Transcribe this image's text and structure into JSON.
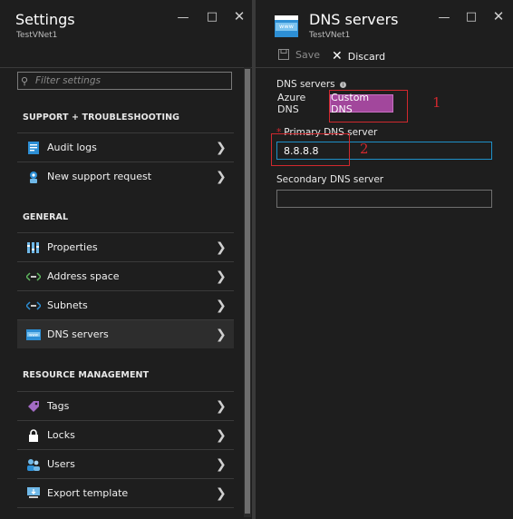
{
  "left_blade": {
    "title": "Settings",
    "subtitle": "TestVNet1",
    "search_placeholder": "Filter settings",
    "sections": [
      {
        "title": "SUPPORT + TROUBLESHOOTING",
        "items": [
          {
            "label": "Audit logs",
            "icon": "audit-logs-icon"
          },
          {
            "label": "New support request",
            "icon": "support-icon"
          }
        ]
      },
      {
        "title": "GENERAL",
        "items": [
          {
            "label": "Properties",
            "icon": "properties-icon"
          },
          {
            "label": "Address space",
            "icon": "address-space-icon"
          },
          {
            "label": "Subnets",
            "icon": "subnets-icon"
          },
          {
            "label": "DNS servers",
            "icon": "dns-servers-icon",
            "selected": true
          }
        ]
      },
      {
        "title": "RESOURCE MANAGEMENT",
        "items": [
          {
            "label": "Tags",
            "icon": "tag-icon"
          },
          {
            "label": "Locks",
            "icon": "lock-icon"
          },
          {
            "label": "Users",
            "icon": "users-icon"
          },
          {
            "label": "Export template",
            "icon": "export-template-icon"
          }
        ]
      }
    ]
  },
  "right_blade": {
    "title": "DNS servers",
    "subtitle": "TestVNet1",
    "icon_text": "www",
    "toolbar": {
      "save_label": "Save",
      "discard_label": "Discard"
    },
    "dns_servers_label": "DNS servers",
    "options": [
      "Azure DNS",
      "Custom DNS"
    ],
    "selected_option": "Custom DNS",
    "primary_label": "Primary DNS server",
    "required_marker": "*",
    "primary_value": "8.8.8.8",
    "secondary_label": "Secondary DNS server",
    "secondary_value": ""
  },
  "annotations": [
    {
      "label": "1"
    },
    {
      "label": "2"
    }
  ],
  "colors": {
    "background": "#1e1e1e",
    "accent_selected": "#a2479c",
    "input_focus": "#1e90c8",
    "annotation_red": "#d0282e",
    "azure_blue": "#2d8fd5"
  }
}
